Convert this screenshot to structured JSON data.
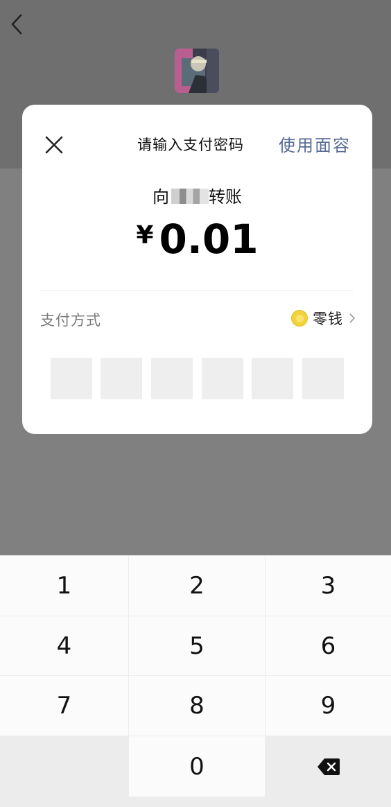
{
  "header": {
    "back_icon": "chevron-left-icon",
    "avatar_icon": "user-avatar"
  },
  "modal": {
    "close_icon": "close-icon",
    "title": "请输入支付密码",
    "face_id_label": "使用面容",
    "transfer_prefix": "向",
    "transfer_suffix": "转账",
    "currency_symbol": "¥",
    "amount": "0.01",
    "payment_method_label": "支付方式",
    "payment_method_value": "零钱",
    "payment_method_icon": "coin-icon",
    "pin_length": 6
  },
  "keypad": {
    "keys": [
      "1",
      "2",
      "3",
      "4",
      "5",
      "6",
      "7",
      "8",
      "9",
      "",
      "0",
      "backspace"
    ],
    "backspace_icon": "backspace-icon"
  },
  "colors": {
    "overlay": "#808080",
    "link": "#576b95",
    "coin": "#f3d33d",
    "key_bg": "#fbfbfb",
    "keypad_bg": "#ececec"
  }
}
